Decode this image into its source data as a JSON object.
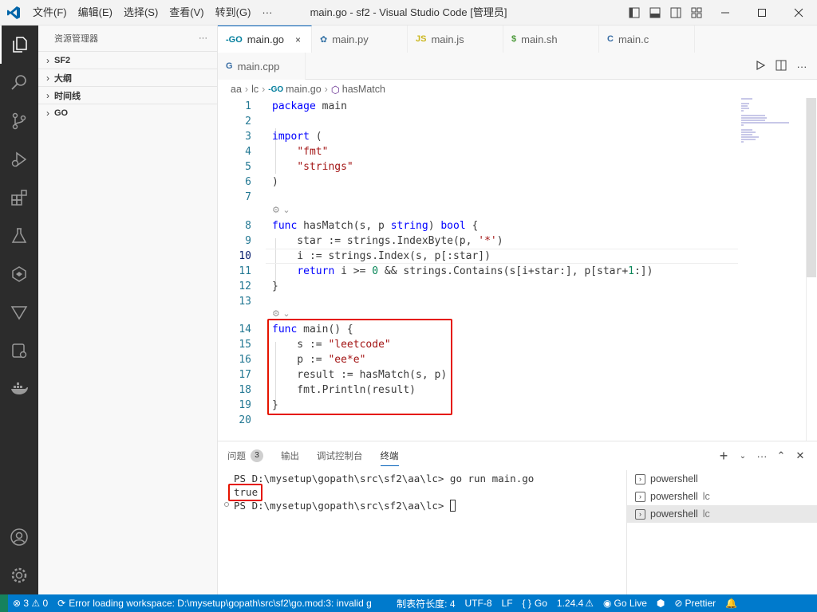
{
  "titlebar": {
    "menus": [
      "文件(F)",
      "编辑(E)",
      "选择(S)",
      "查看(V)",
      "转到(G)",
      "···"
    ],
    "title": "main.go - sf2 - Visual Studio Code [管理员]"
  },
  "sidebar": {
    "header": "资源管理器",
    "more": "···",
    "sections": [
      "SF2",
      "大纲",
      "时间线",
      "GO"
    ]
  },
  "tabs": [
    {
      "icon": "-GO",
      "label": "main.go",
      "close": "×"
    },
    {
      "icon": "✿",
      "label": "main.py"
    },
    {
      "icon": "JS",
      "label": "main.js"
    },
    {
      "icon": "$",
      "label": "main.sh"
    },
    {
      "icon": "C",
      "label": "main.c"
    },
    {
      "icon": "G",
      "label": "main.cpp"
    }
  ],
  "breadcrumb": {
    "parts": [
      "aa",
      "lc",
      "main.go",
      "hasMatch"
    ],
    "go_icon": "-GO"
  },
  "editor": {
    "lines": [
      {
        "n": "1",
        "html": "<span class='k'>package</span> main"
      },
      {
        "n": "2",
        "html": ""
      },
      {
        "n": "3",
        "html": "<span class='k'>import</span> ("
      },
      {
        "n": "4",
        "html": "    <span class='s'>\"fmt\"</span>"
      },
      {
        "n": "5",
        "html": "    <span class='s'>\"strings\"</span>"
      },
      {
        "n": "6",
        "html": ")"
      },
      {
        "n": "7",
        "html": ""
      },
      {
        "n": "8",
        "html": "<span class='k'>func</span> hasMatch(s, p <span class='t'>string</span>) <span class='t'>bool</span> {"
      },
      {
        "n": "9",
        "html": "    star := strings.IndexByte(p, <span class='s'>'*'</span>)"
      },
      {
        "n": "10",
        "html": "    i := strings.Index(s, p[:star])"
      },
      {
        "n": "11",
        "html": "    <span class='k'>return</span> i >= <span class='n'>0</span> && strings.Contains(s[i+star:], p[star+<span class='n'>1</span>:])"
      },
      {
        "n": "12",
        "html": "}"
      },
      {
        "n": "13",
        "html": ""
      },
      {
        "n": "14",
        "html": "<span class='k'>func</span> main() {"
      },
      {
        "n": "15",
        "html": "    s := <span class='s'>\"leetcode\"</span>"
      },
      {
        "n": "16",
        "html": "    p := <span class='s'>\"ee*e\"</span>"
      },
      {
        "n": "17",
        "html": "    result := hasMatch(s, p)"
      },
      {
        "n": "18",
        "html": "    fmt.Println(result)"
      },
      {
        "n": "19",
        "html": "}"
      },
      {
        "n": "20",
        "html": ""
      }
    ]
  },
  "panel": {
    "tabs": [
      {
        "label": "问题",
        "badge": "3"
      },
      {
        "label": "输出"
      },
      {
        "label": "调试控制台"
      },
      {
        "label": "终端"
      }
    ],
    "terminal": {
      "line1": "PS D:\\mysetup\\gopath\\src\\sf2\\aa\\lc> go run main.go",
      "line2": "true",
      "line3": "PS D:\\mysetup\\gopath\\src\\sf2\\aa\\lc> "
    },
    "terminals": [
      {
        "name": "powershell",
        "cwd": ""
      },
      {
        "name": "powershell",
        "cwd": "lc"
      },
      {
        "name": "powershell",
        "cwd": "lc"
      }
    ]
  },
  "statusbar": {
    "remote": "⊗ 3 ⚠ 0",
    "workspace": "Error loading workspace: D:\\mysetup\\gopath\\src\\sf2\\go.mod:3: invalid g",
    "tabsize": "制表符长度: 4",
    "encoding": "UTF-8",
    "eol": "LF",
    "language": "Go",
    "go_version": "1.24.4",
    "golive": "Go Live",
    "prettier": "Prettier"
  }
}
